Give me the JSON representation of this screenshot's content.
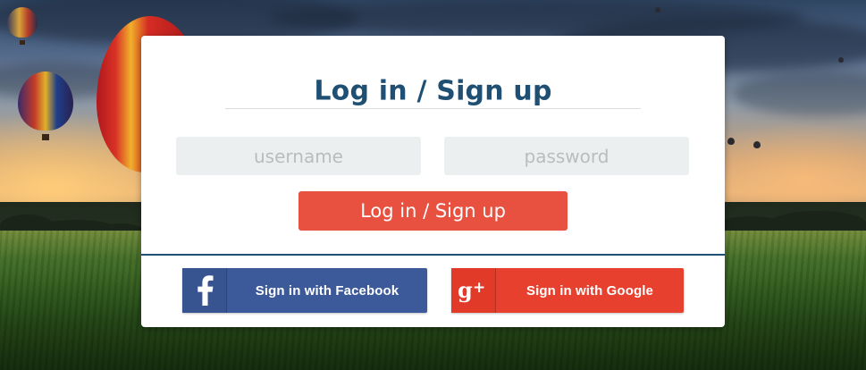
{
  "login": {
    "title": "Log in / Sign up",
    "username_placeholder": "username",
    "password_placeholder": "password",
    "submit_label": "Log in / Sign up"
  },
  "social": {
    "facebook_label": "Sign in with Facebook",
    "google_label": "Sign in with Google"
  },
  "colors": {
    "title": "#1f4f73",
    "primary_button": "#e8503f",
    "facebook": "#3c5a9a",
    "google": "#e8402e",
    "field_bg": "#ecefef"
  },
  "icons": [
    "facebook-icon",
    "google-plus-icon"
  ]
}
